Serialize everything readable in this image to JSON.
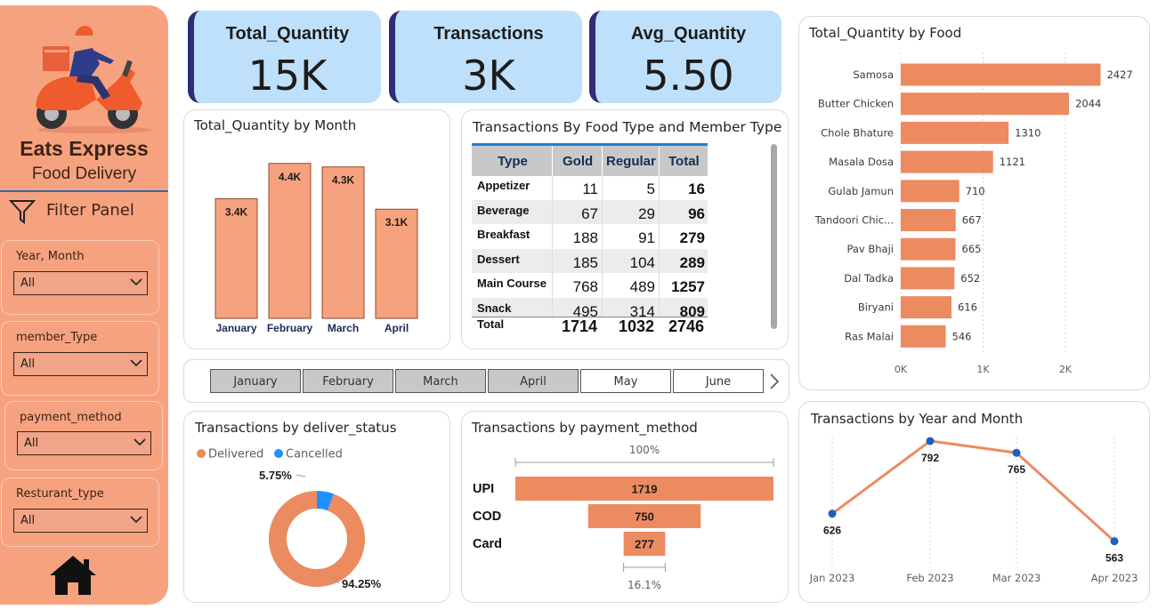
{
  "sidebar": {
    "brand_title": "Eats Express",
    "brand_subtitle": "Food Delivery",
    "filter_panel_label": "Filter Panel",
    "filters": [
      {
        "label": "Year, Month",
        "value": "All"
      },
      {
        "label": "member_Type",
        "value": "All"
      },
      {
        "label": "payment_method",
        "value": "All"
      },
      {
        "label": "Resturant_type",
        "value": "All"
      }
    ]
  },
  "kpis": [
    {
      "title": "Total_Quantity",
      "value": "15K"
    },
    {
      "title": "Transactions",
      "value": "3K"
    },
    {
      "title": "Avg_Quantity",
      "value": "5.50"
    }
  ],
  "month_chart": {
    "title": "Total_Quantity by Month",
    "chart_data": {
      "type": "bar",
      "categories": [
        "January",
        "February",
        "March",
        "April"
      ],
      "values": [
        3.4,
        4.4,
        4.3,
        3.1
      ],
      "data_labels": [
        "3.4K",
        "4.4K",
        "4.3K",
        "3.1K"
      ],
      "color": "#f7a27f"
    }
  },
  "matrix": {
    "title": "Transactions By Food Type and Member Type",
    "headers": [
      "Type",
      "Gold",
      "Regular",
      "Total"
    ],
    "rows": [
      {
        "type": "Appetizer",
        "gold": "11",
        "regular": "5",
        "total": "16"
      },
      {
        "type": "Beverage",
        "gold": "67",
        "regular": "29",
        "total": "96"
      },
      {
        "type": "Breakfast",
        "gold": "188",
        "regular": "91",
        "total": "279"
      },
      {
        "type": "Dessert",
        "gold": "185",
        "regular": "104",
        "total": "289"
      },
      {
        "type": "Main Course",
        "gold": "768",
        "regular": "489",
        "total": "1257"
      },
      {
        "type": "Snack",
        "gold": "495",
        "regular": "314",
        "total": "809"
      }
    ],
    "total_row": {
      "type": "Total",
      "gold": "1714",
      "regular": "1032",
      "total": "2746"
    }
  },
  "month_slicer": {
    "items": [
      "January",
      "February",
      "March",
      "April",
      "May",
      "June"
    ],
    "selected": [
      "January",
      "February",
      "March",
      "April"
    ]
  },
  "food_chart": {
    "title": "Total_Quantity by Food",
    "chart_data": {
      "type": "bar",
      "orientation": "horizontal",
      "categories": [
        "Samosa",
        "Butter Chicken",
        "Chole Bhature",
        "Masala Dosa",
        "Gulab Jamun",
        "Tandoori Chic...",
        "Pav Bhaji",
        "Dal Tadka",
        "Biryani",
        "Ras Malai"
      ],
      "values": [
        2427,
        2044,
        1310,
        1121,
        710,
        667,
        665,
        652,
        616,
        546
      ],
      "xticks": [
        "0K",
        "1K",
        "2K"
      ],
      "xlim": [
        0,
        2500
      ],
      "color": "#ec8b60"
    }
  },
  "status_chart": {
    "title": "Transactions by deliver_status",
    "chart_data": {
      "type": "pie",
      "donut": true,
      "labels": [
        "Delivered",
        "Cancelled"
      ],
      "values": [
        94.25,
        5.75
      ],
      "data_labels": [
        "94.25%",
        "5.75%"
      ],
      "colors": [
        "#ec8b60",
        "#1e90ff"
      ]
    }
  },
  "payment_chart": {
    "title": "Transactions by payment_method",
    "top_label": "100%",
    "bottom_label": "16.1%",
    "chart_data": {
      "type": "bar",
      "subtype": "funnel",
      "categories": [
        "UPI",
        "COD",
        "Card"
      ],
      "values": [
        1719,
        750,
        277
      ],
      "color": "#ec8b60"
    }
  },
  "trend_chart": {
    "title": "Transactions by Year and Month",
    "chart_data": {
      "type": "line",
      "x": [
        "Jan 2023",
        "Feb 2023",
        "Mar 2023",
        "Apr 2023"
      ],
      "values": [
        626,
        792,
        765,
        563
      ],
      "ylim": [
        540,
        800
      ],
      "line_color": "#ec8b60",
      "marker_color": "#1f5fbf"
    }
  }
}
